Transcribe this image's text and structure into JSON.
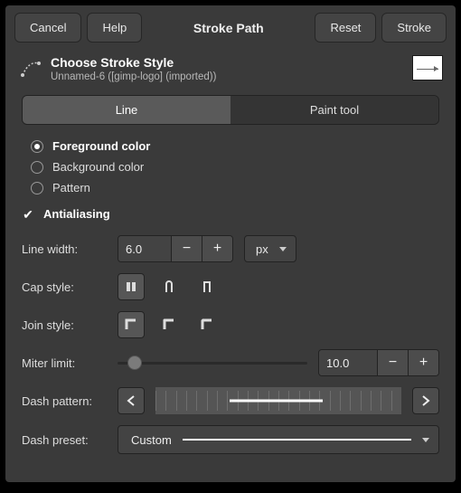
{
  "titlebar": {
    "cancel": "Cancel",
    "help": "Help",
    "title": "Stroke Path",
    "reset": "Reset",
    "stroke": "Stroke"
  },
  "header": {
    "title": "Choose Stroke Style",
    "subtitle": "Unnamed-6 ([gimp-logo] (imported))"
  },
  "tabs": {
    "line": "Line",
    "paint": "Paint tool"
  },
  "source": {
    "fg": "Foreground color",
    "bg": "Background color",
    "pattern": "Pattern",
    "selected": "fg"
  },
  "antialias": {
    "label": "Antialiasing",
    "checked": true
  },
  "linewidth": {
    "label": "Line width:",
    "value": "6.0",
    "unit": "px"
  },
  "cap": {
    "label": "Cap style:"
  },
  "join": {
    "label": "Join style:"
  },
  "miter": {
    "label": "Miter limit:",
    "value": "10.0",
    "slider_pct": 9
  },
  "dash": {
    "label": "Dash pattern:"
  },
  "preset": {
    "label": "Dash preset:",
    "value": "Custom"
  }
}
